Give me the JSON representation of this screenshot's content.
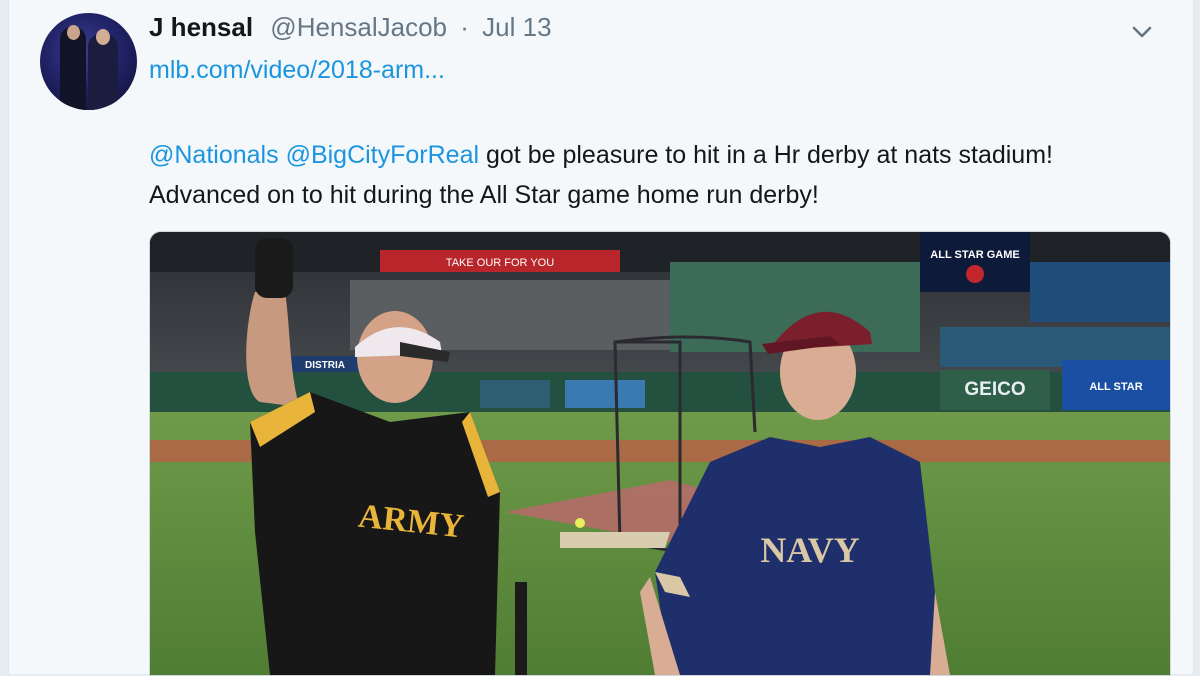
{
  "tweet": {
    "display_name": "J hensal",
    "handle": "@HensalJacob",
    "separator": "·",
    "date": "Jul 13",
    "link": "mlb.com/video/2018-arm...",
    "mention1": "@Nationals",
    "mention2": "@BigCityForReal",
    "text_line1_rest": "got be pleasure to hit in a Hr derby at nats stadium!",
    "text_line2": "Advanced on to hit during the All Star game home run derby!"
  },
  "media": {
    "scoreboard_text": "ALL STAR GAME",
    "ad_geico": "GEICO",
    "ad_allstar": "ALL STAR",
    "jersey_left": "ARMY",
    "jersey_right": "NAVY",
    "wall_sign": "DISTRIA",
    "banner": "TAKE OUR FOR YOU"
  },
  "colors": {
    "link_blue": "#1b95e0",
    "field_green": "#5b8a3c",
    "army_gold": "#e8b53a",
    "navy_blue": "#1f2f6b"
  },
  "icons": {
    "menu": "chevron-down-icon"
  }
}
